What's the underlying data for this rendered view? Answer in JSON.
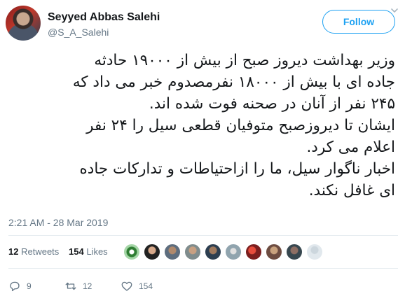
{
  "user": {
    "name": "Seyyed Abbas Salehi",
    "handle": "@S_A_Salehi"
  },
  "follow": {
    "label": "Follow"
  },
  "tweet": {
    "lines": [
      "وزیر بهداشت دیروز صبح از بیش از ۱۹۰۰۰ حادثه",
      "جاده ای با بیش از ۱۸۰۰۰ نفرمصدوم خبر می داد که",
      "۲۴۵ نفر از آنان در صحنه فوت شده اند.",
      "ایشان تا دیروزصبح متوفیان قطعی سیل را ۲۴ نفر",
      "اعلام می کرد.",
      "اخبار ناگوار سیل،  ما را ازاحتیاطات و تدارکات جاده",
      "ای غافل نکند."
    ],
    "timestamp": "2:21 AM - 28 Mar 2019"
  },
  "stats": {
    "retweets_count": "12",
    "retweets_label": "Retweets",
    "likes_count": "154",
    "likes_label": "Likes"
  },
  "actions": {
    "replies": "9",
    "retweets": "12",
    "likes": "154"
  },
  "colors": {
    "accent": "#1da1f2",
    "muted": "#657786",
    "text": "#14171a"
  }
}
